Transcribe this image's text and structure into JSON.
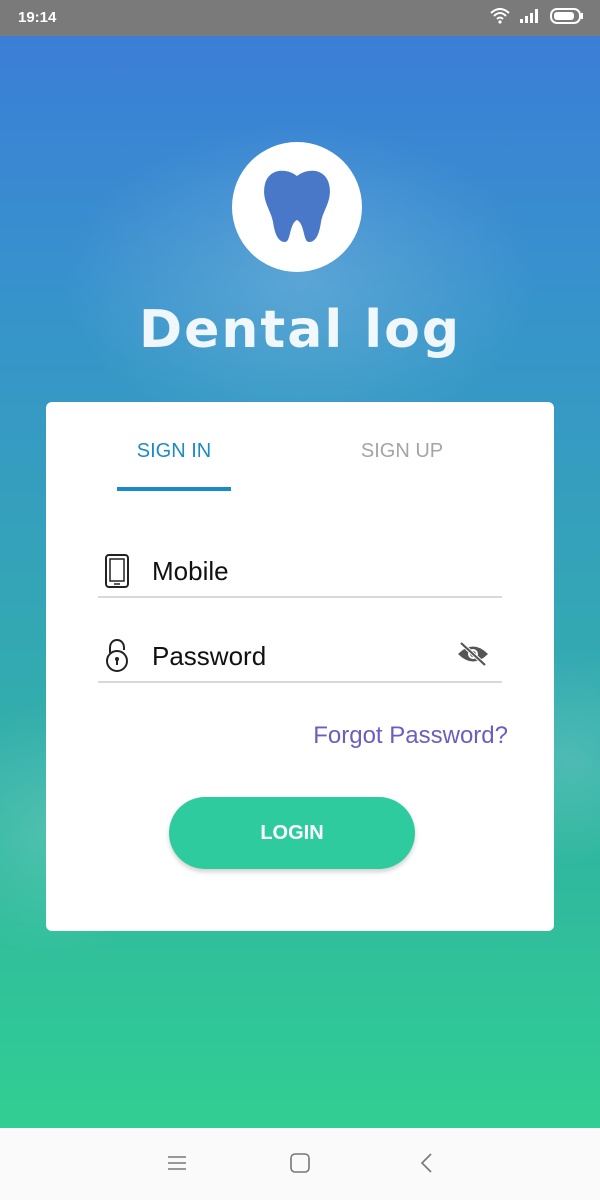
{
  "status_bar": {
    "time": "19:14",
    "icons": [
      "wifi-icon",
      "signal-icon",
      "battery-icon"
    ]
  },
  "brand": {
    "name": "Dental log",
    "logo_icon": "tooth-icon"
  },
  "tabs": [
    {
      "label": "SIGN IN",
      "active": true
    },
    {
      "label": "SIGN UP",
      "active": false
    }
  ],
  "form": {
    "mobile": {
      "placeholder": "Mobile",
      "value": "",
      "icon": "phone-icon"
    },
    "password": {
      "placeholder": "Password",
      "value": "",
      "icon": "lock-icon",
      "toggle_icon": "eye-off-icon"
    },
    "forgot_label": "Forgot Password?",
    "login_label": "LOGIN"
  },
  "nav_bar": {
    "buttons": [
      "menu-icon",
      "home-icon",
      "back-icon"
    ]
  },
  "colors": {
    "accent": "#1a8bc8",
    "login_button": "#2ecb9e",
    "link": "#6a5fc0",
    "gradient_top": "#3c7bd8",
    "gradient_bottom": "#32d590"
  }
}
